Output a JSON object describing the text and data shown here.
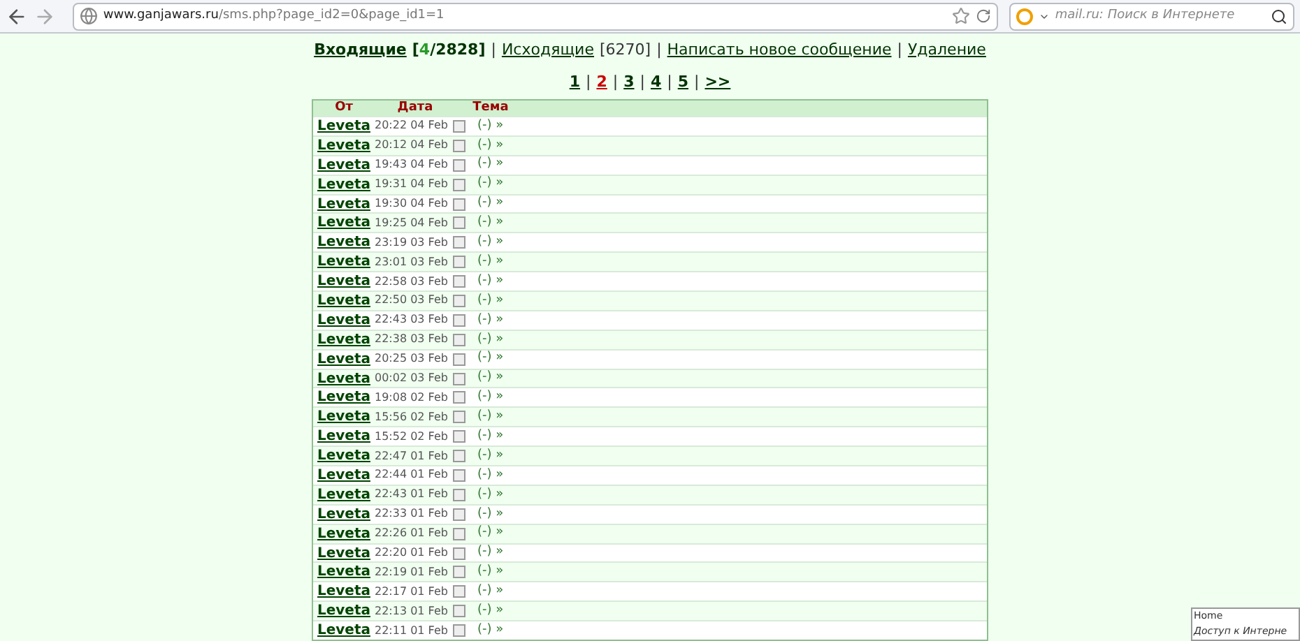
{
  "browser": {
    "url_host": "www.ganjawars.ru",
    "url_path": "/sms.php?page_id2=0&page_id1=1",
    "search_placeholder": "mail.ru: Поиск в Интернете"
  },
  "nav": {
    "inbox": "Входящие",
    "inbox_open": "[",
    "inbox_unread": "4",
    "inbox_total": "/2828]",
    "sep1": "|",
    "outbox": "Исходящие",
    "outbox_count": "[6270]",
    "sep2": "|",
    "compose": "Написать новое сообщение",
    "sep3": "|",
    "delete": "Удаление"
  },
  "pages": [
    {
      "label": "1",
      "selected": false
    },
    {
      "label": "2",
      "selected": true
    },
    {
      "label": "3",
      "selected": false
    },
    {
      "label": "4",
      "selected": false
    },
    {
      "label": "5",
      "selected": false
    },
    {
      "label": ">>",
      "selected": false
    }
  ],
  "page_sep": "|",
  "table": {
    "columns": [
      "От",
      "Дата",
      "Тема"
    ],
    "rows": [
      {
        "from": "Leveta",
        "date": "20:22 04 Feb",
        "checked": false,
        "subject": "(-) »"
      },
      {
        "from": "Leveta",
        "date": "20:12 04 Feb",
        "checked": false,
        "subject": "(-) »"
      },
      {
        "from": "Leveta",
        "date": "19:43 04 Feb",
        "checked": false,
        "subject": "(-) »"
      },
      {
        "from": "Leveta",
        "date": "19:31 04 Feb",
        "checked": false,
        "subject": "(-) »"
      },
      {
        "from": "Leveta",
        "date": "19:30 04 Feb",
        "checked": false,
        "subject": "(-) »"
      },
      {
        "from": "Leveta",
        "date": "19:25 04 Feb",
        "checked": false,
        "subject": "(-) »"
      },
      {
        "from": "Leveta",
        "date": "23:19 03 Feb",
        "checked": false,
        "subject": "(-) »"
      },
      {
        "from": "Leveta",
        "date": "23:01 03 Feb",
        "checked": false,
        "subject": "(-) »"
      },
      {
        "from": "Leveta",
        "date": "22:58 03 Feb",
        "checked": false,
        "subject": "(-) »"
      },
      {
        "from": "Leveta",
        "date": "22:50 03 Feb",
        "checked": false,
        "subject": "(-) »"
      },
      {
        "from": "Leveta",
        "date": "22:43 03 Feb",
        "checked": false,
        "subject": "(-) »"
      },
      {
        "from": "Leveta",
        "date": "22:38 03 Feb",
        "checked": false,
        "subject": "(-) »"
      },
      {
        "from": "Leveta",
        "date": "20:25 03 Feb",
        "checked": false,
        "subject": "(-) »"
      },
      {
        "from": "Leveta",
        "date": "00:02 03 Feb",
        "checked": false,
        "subject": "(-) »"
      },
      {
        "from": "Leveta",
        "date": "19:08 02 Feb",
        "checked": false,
        "subject": "(-) »"
      },
      {
        "from": "Leveta",
        "date": "15:56 02 Feb",
        "checked": false,
        "subject": "(-) »"
      },
      {
        "from": "Leveta",
        "date": "15:52 02 Feb",
        "checked": false,
        "subject": "(-) »"
      },
      {
        "from": "Leveta",
        "date": "22:47 01 Feb",
        "checked": false,
        "subject": "(-) »"
      },
      {
        "from": "Leveta",
        "date": "22:44 01 Feb",
        "checked": false,
        "subject": "(-) »"
      },
      {
        "from": "Leveta",
        "date": "22:43 01 Feb",
        "checked": false,
        "subject": "(-) »"
      },
      {
        "from": "Leveta",
        "date": "22:33 01 Feb",
        "checked": false,
        "subject": "(-) »"
      },
      {
        "from": "Leveta",
        "date": "22:26 01 Feb",
        "checked": false,
        "subject": "(-) »"
      },
      {
        "from": "Leveta",
        "date": "22:20 01 Feb",
        "checked": false,
        "subject": "(-) »"
      },
      {
        "from": "Leveta",
        "date": "22:19 01 Feb",
        "checked": false,
        "subject": "(-) »"
      },
      {
        "from": "Leveta",
        "date": "22:17 01 Feb",
        "checked": false,
        "subject": "(-) »"
      },
      {
        "from": "Leveta",
        "date": "22:13 01 Feb",
        "checked": false,
        "subject": "(-) »"
      },
      {
        "from": "Leveta",
        "date": "22:11 01 Feb",
        "checked": false,
        "subject": "(-) »"
      }
    ]
  },
  "tooltip": {
    "title": "Home",
    "text": "Доступ к Интерне"
  }
}
